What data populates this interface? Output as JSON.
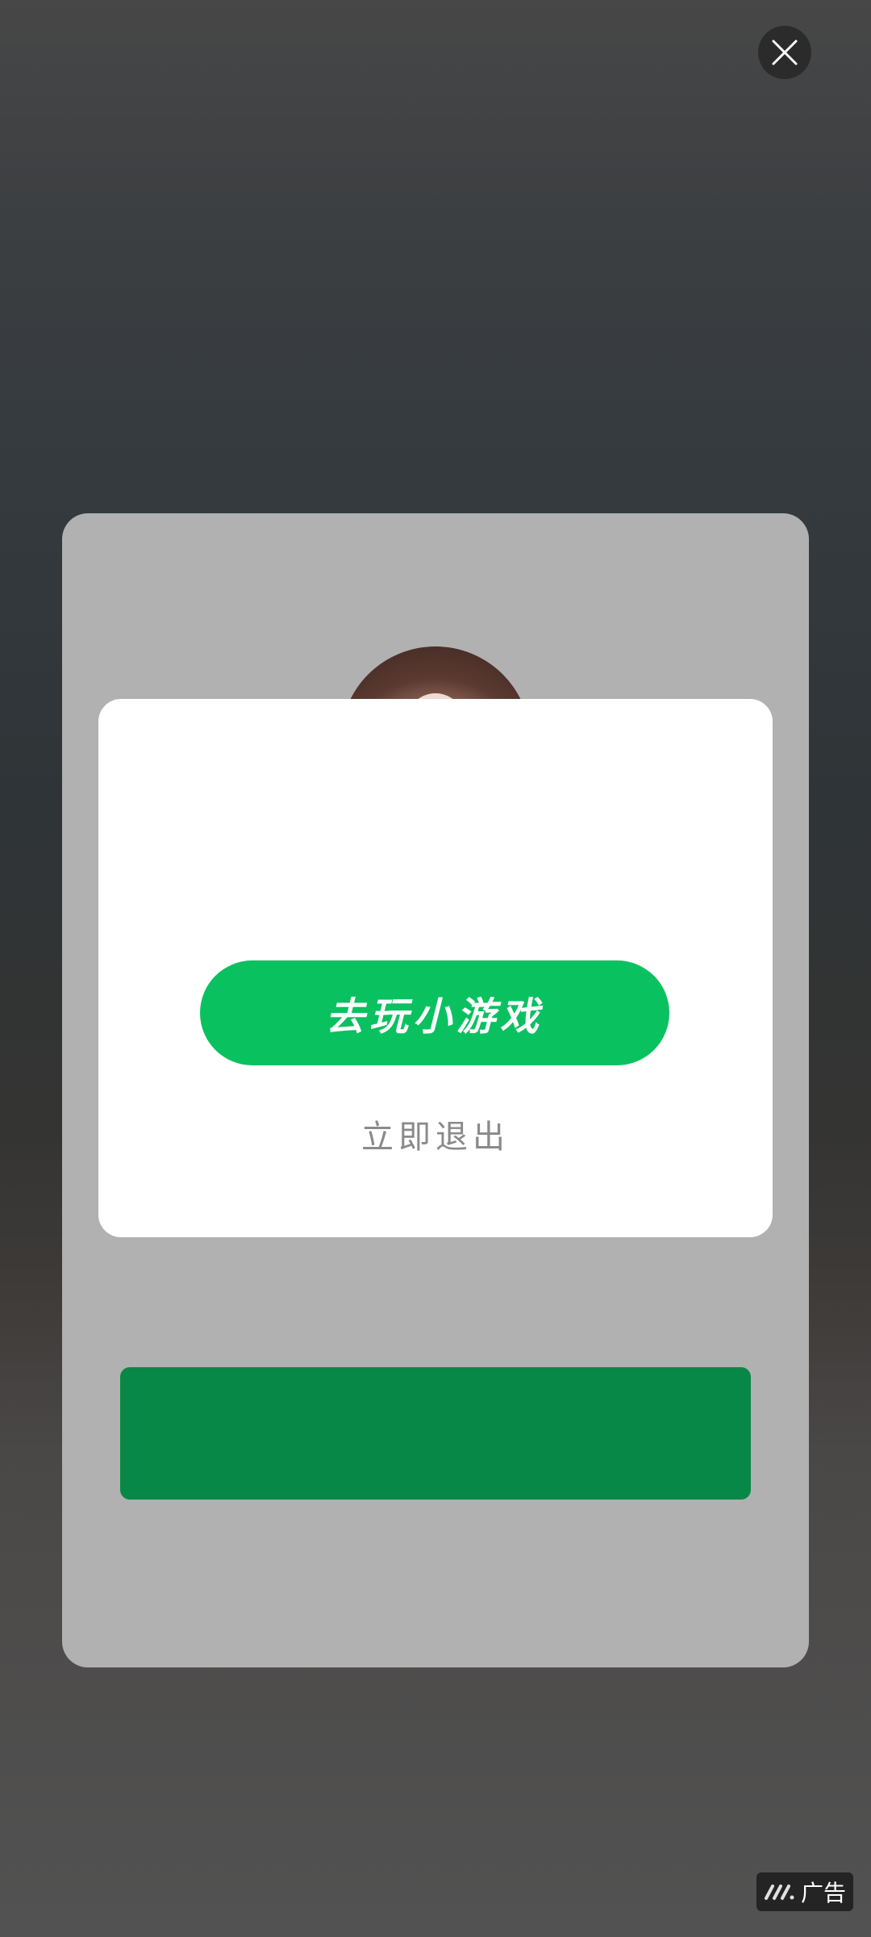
{
  "dialog": {
    "primary_button_label": "去玩小游戏",
    "secondary_link_label": "立即退出"
  },
  "ad_badge": {
    "label": "广告",
    "icon": "ad-brand-logo-icon"
  },
  "close_button": {
    "icon": "close-icon"
  },
  "colors": {
    "primary_green": "#0ac160",
    "ad_bar_green": "#088847",
    "card_gray": "#b1b1b1"
  }
}
